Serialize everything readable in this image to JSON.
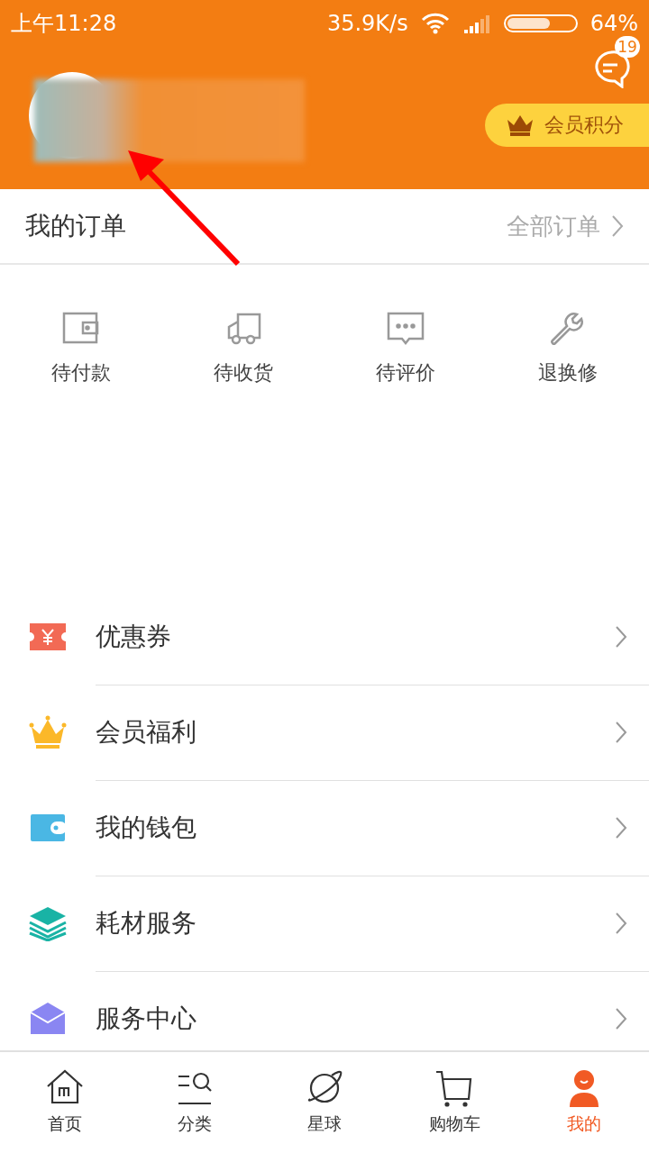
{
  "status_bar": {
    "time": "上午11:28",
    "speed": "35.9K/s",
    "battery": "64%"
  },
  "header": {
    "message_badge": "19",
    "points_button": "会员积分"
  },
  "orders": {
    "title": "我的订单",
    "all_link": "全部订单",
    "items": [
      {
        "kind": "wallet",
        "label": "待付款"
      },
      {
        "kind": "truck",
        "label": "待收货"
      },
      {
        "kind": "chat",
        "label": "待评价"
      },
      {
        "kind": "wrench",
        "label": "退换修"
      }
    ]
  },
  "menu": [
    {
      "kind": "coupon",
      "label": "优惠券"
    },
    {
      "kind": "crown",
      "label": "会员福利"
    },
    {
      "kind": "wallet",
      "label": "我的钱包"
    },
    {
      "kind": "layers",
      "label": "耗材服务"
    },
    {
      "kind": "service",
      "label": "服务中心"
    }
  ],
  "tabs": [
    {
      "kind": "home",
      "label": "首页",
      "selected": false
    },
    {
      "kind": "category",
      "label": "分类",
      "selected": false
    },
    {
      "kind": "planet",
      "label": "星球",
      "selected": false
    },
    {
      "kind": "cart",
      "label": "购物车",
      "selected": false
    },
    {
      "kind": "me",
      "label": "我的",
      "selected": true
    }
  ]
}
